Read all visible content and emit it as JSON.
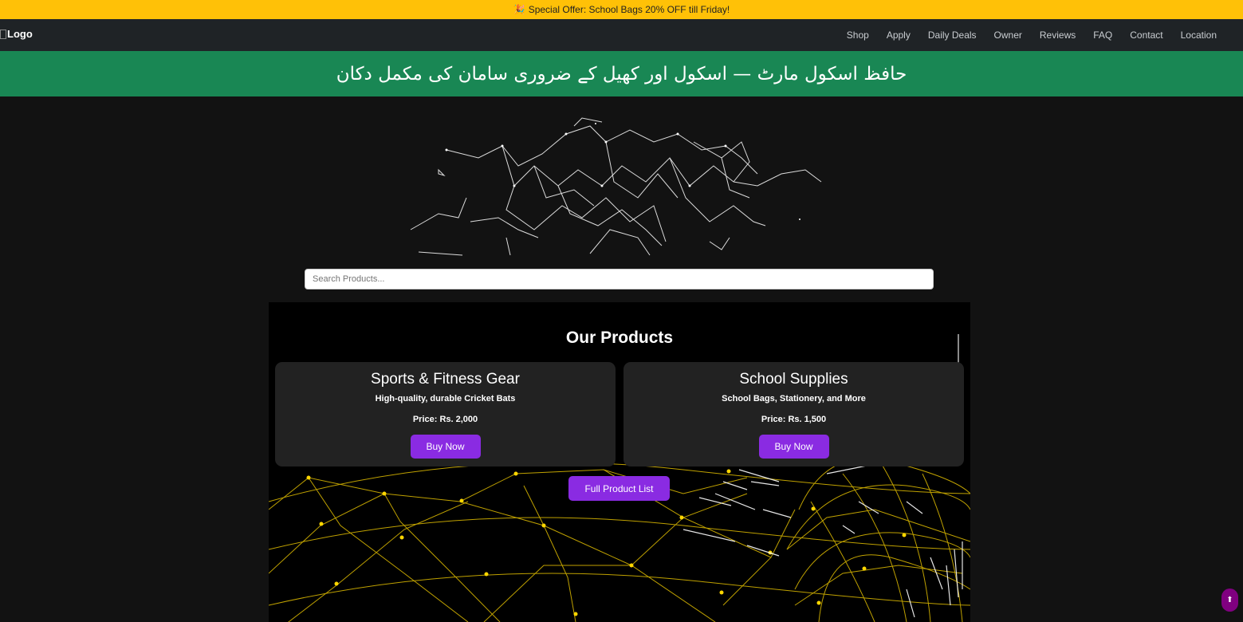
{
  "offer": {
    "icon": "party-popper-icon",
    "glyph": "🎉",
    "text": "Special Offer: School Bags 20% OFF till Friday!"
  },
  "nav": {
    "logo_alt": "Logo",
    "links": [
      "Shop",
      "Apply",
      "Daily Deals",
      "Owner",
      "Reviews",
      "FAQ",
      "Contact",
      "Location"
    ]
  },
  "banner": {
    "text": "حافظ اسکول مارٹ — اسکول اور کھیل کے ضروری سامان کی مکمل دکان"
  },
  "search": {
    "placeholder": "Search Products..."
  },
  "products": {
    "title": "Our Products",
    "cards": [
      {
        "title": "Sports & Fitness Gear",
        "desc": "High-quality, durable Cricket Bats",
        "price": "Price: Rs. 2,000",
        "button": "Buy Now"
      },
      {
        "title": "School Supplies",
        "desc": "School Bags, Stationery, and More",
        "price": "Price: Rs. 1,500",
        "button": "Buy Now"
      }
    ],
    "full_list": "Full Product List"
  },
  "scroll_top": {
    "icon": "arrow-up-icon",
    "glyph": "⬆"
  },
  "colors": {
    "offer_bg": "#ffc107",
    "banner_bg": "#198754",
    "accent": "#8a2be2",
    "globe": "#ffd700"
  }
}
